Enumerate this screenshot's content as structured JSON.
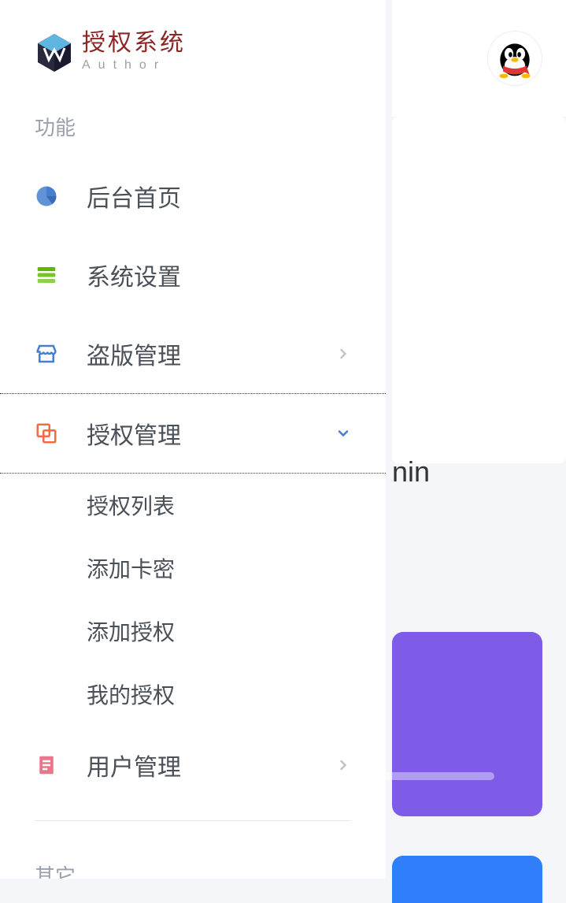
{
  "logo": {
    "title": "授权系统",
    "subtitle": "Author"
  },
  "sections": {
    "functions": "功能",
    "other": "其它"
  },
  "nav": {
    "dashboard": "后台首页",
    "settings": "系统设置",
    "piracy": "盗版管理",
    "auth": "授权管理",
    "users": "用户管理"
  },
  "authSubmenu": {
    "list": "授权列表",
    "addCard": "添加卡密",
    "addAuth": "添加授权",
    "myAuth": "我的授权"
  },
  "main": {
    "partialText": "nin"
  },
  "colors": {
    "iconBlue": "#467fcf",
    "iconGreen": "#5eba00",
    "iconOrange": "#f66c3e",
    "iconPink": "#e85d79"
  }
}
